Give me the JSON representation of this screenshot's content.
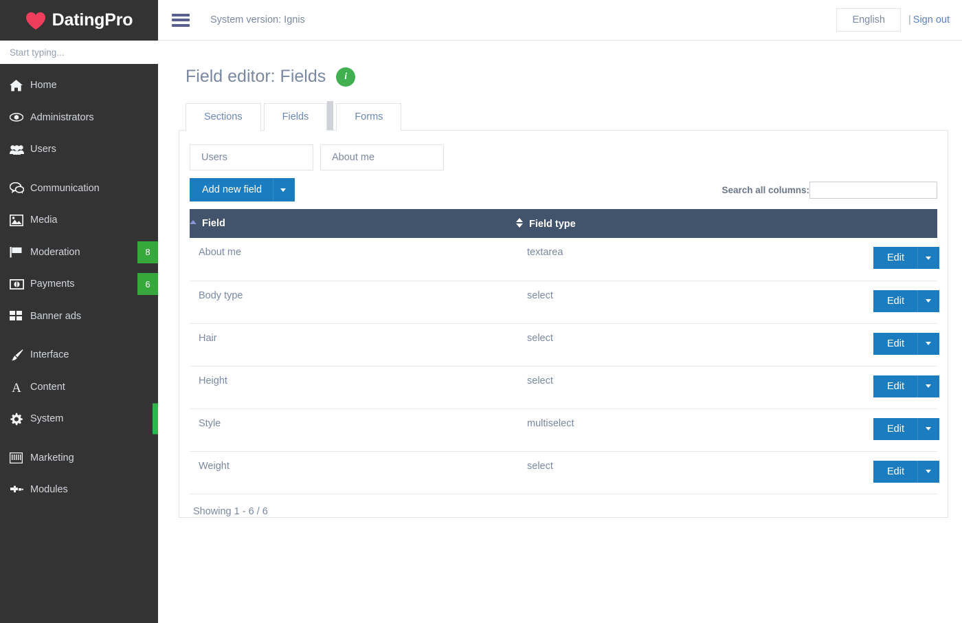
{
  "brand": {
    "name": "DatingPro",
    "logo_icon": "heart-icon",
    "logo_color": "#ef3e5c"
  },
  "sidebar": {
    "search_placeholder": "Start typing...",
    "active_item": "System",
    "items": [
      {
        "label": "Home",
        "icon": "home-icon",
        "badge": null
      },
      {
        "label": "Administrators",
        "icon": "eye-icon",
        "badge": null
      },
      {
        "label": "Users",
        "icon": "users-icon",
        "badge": null
      },
      {
        "label": "Communication",
        "icon": "chat-icon",
        "badge": null
      },
      {
        "label": "Media",
        "icon": "image-icon",
        "badge": null
      },
      {
        "label": "Moderation",
        "icon": "flag-icon",
        "badge": "8"
      },
      {
        "label": "Payments",
        "icon": "money-icon",
        "badge": "6"
      },
      {
        "label": "Banner ads",
        "icon": "grid-icon",
        "badge": null
      },
      {
        "label": "Interface",
        "icon": "paintbrush-icon",
        "badge": null
      },
      {
        "label": "Content",
        "icon": "letter-a-icon",
        "badge": null
      },
      {
        "label": "System",
        "icon": "gear-icon",
        "badge": null
      },
      {
        "label": "Marketing",
        "icon": "barcode-icon",
        "badge": null
      },
      {
        "label": "Modules",
        "icon": "puzzle-icon",
        "badge": null
      }
    ],
    "badge_color": "#37a93c",
    "active_bar_color": "#33b44a"
  },
  "topbar": {
    "menu_icon": "hamburger-icon",
    "system_version": "System version: Ignis",
    "language": "English",
    "separator": "|",
    "sign_out": "Sign out"
  },
  "page": {
    "title": "Field editor: Fields",
    "info_icon_label": "i",
    "info_icon_color": "#40b050"
  },
  "tabs": [
    {
      "label": "Sections",
      "active": false
    },
    {
      "label": "Fields",
      "active": true
    },
    {
      "label": "Forms",
      "active": false
    }
  ],
  "filters": [
    {
      "label": "Users"
    },
    {
      "label": "About me"
    }
  ],
  "toolbar": {
    "add_new_field_label": "Add new field",
    "add_caret_icon": "chevron-down-icon",
    "button_color": "#1b7cbf"
  },
  "search": {
    "label": "Search all columns:",
    "value": "",
    "placeholder": ""
  },
  "table": {
    "columns": [
      {
        "label": "Field",
        "sort": "asc"
      },
      {
        "label": "Field type",
        "sort": "none"
      }
    ],
    "rows": [
      {
        "field": "About me",
        "type": "textarea",
        "action": "Edit"
      },
      {
        "field": "Body type",
        "type": "select",
        "action": "Edit"
      },
      {
        "field": "Hair",
        "type": "select",
        "action": "Edit"
      },
      {
        "field": "Height",
        "type": "select",
        "action": "Edit"
      },
      {
        "field": "Style",
        "type": "multiselect",
        "action": "Edit"
      },
      {
        "field": "Weight",
        "type": "select",
        "action": "Edit"
      }
    ],
    "footer": "Showing 1 - 6 / 6",
    "header_color": "#42546b"
  }
}
